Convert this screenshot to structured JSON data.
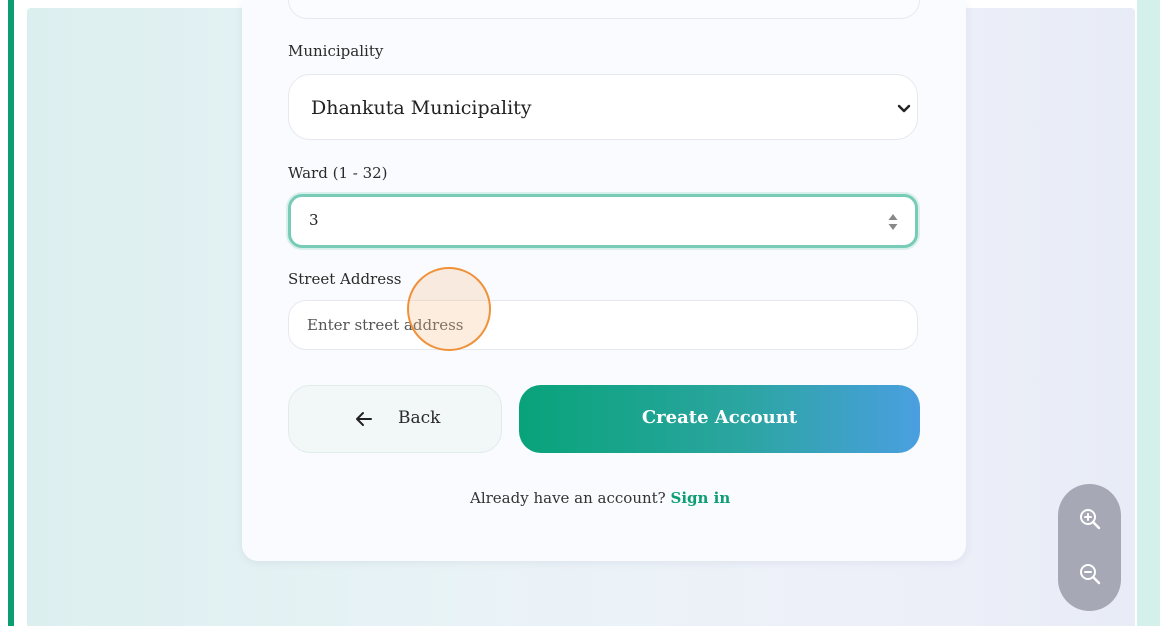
{
  "form": {
    "municipality": {
      "label": "Municipality",
      "selected": "Dhankuta Municipality"
    },
    "ward": {
      "label": "Ward (1 - 32)",
      "value": "3"
    },
    "street": {
      "label": "Street Address",
      "placeholder": "Enter street address"
    }
  },
  "actions": {
    "back_label": "Back",
    "create_label": "Create Account"
  },
  "footer": {
    "prompt": "Already have an account?",
    "signin_label": "Sign in"
  },
  "zoom": {
    "in_icon": "zoom-in-icon",
    "out_icon": "zoom-out-icon"
  },
  "colors": {
    "accent": "#0a9e72",
    "gradient_start": "#08a37a",
    "gradient_end": "#4a9fe0",
    "focus_ring": "#78cbb6",
    "click_indicator": "#f0913a"
  }
}
